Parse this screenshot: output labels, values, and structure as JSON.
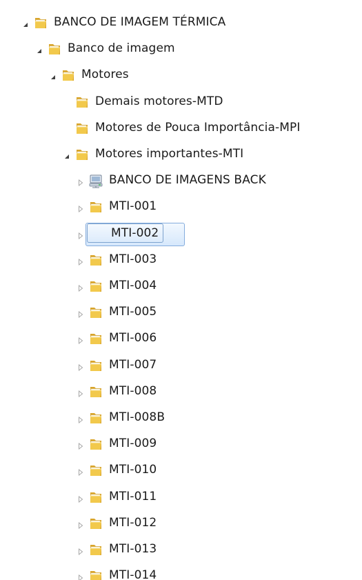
{
  "tree": {
    "selected_index": 6,
    "nodes": [
      {
        "label": "BANCO DE IMAGEM  TÉRMICA",
        "depth": 0,
        "expander": "expanded",
        "icon": "folder-icon"
      },
      {
        "label": "Banco de imagem",
        "depth": 1,
        "expander": "expanded",
        "icon": "folder-icon"
      },
      {
        "label": "Motores",
        "depth": 2,
        "expander": "expanded",
        "icon": "folder-icon"
      },
      {
        "label": "Demais motores-MTD",
        "depth": 3,
        "expander": "none",
        "icon": "folder-icon"
      },
      {
        "label": "Motores  de Pouca Importância-MPI",
        "depth": 3,
        "expander": "none",
        "icon": "folder-icon"
      },
      {
        "label": "Motores importantes-MTI",
        "depth": 3,
        "expander": "expanded",
        "icon": "folder-icon"
      },
      {
        "label": "BANCO DE IMAGENS BACK",
        "depth": 4,
        "expander": "collapsed",
        "icon": "network-drive-icon"
      },
      {
        "label": "MTI-001",
        "depth": 4,
        "expander": "collapsed",
        "icon": "folder-icon"
      },
      {
        "label": "MTI-002",
        "depth": 4,
        "expander": "collapsed",
        "icon": "folder-icon",
        "selected": true
      },
      {
        "label": "MTI-003",
        "depth": 4,
        "expander": "collapsed",
        "icon": "folder-icon"
      },
      {
        "label": "MTI-004",
        "depth": 4,
        "expander": "collapsed",
        "icon": "folder-icon"
      },
      {
        "label": "MTI-005",
        "depth": 4,
        "expander": "collapsed",
        "icon": "folder-icon"
      },
      {
        "label": "MTI-006",
        "depth": 4,
        "expander": "collapsed",
        "icon": "folder-icon"
      },
      {
        "label": "MTI-007",
        "depth": 4,
        "expander": "collapsed",
        "icon": "folder-icon"
      },
      {
        "label": "MTI-008",
        "depth": 4,
        "expander": "collapsed",
        "icon": "folder-icon"
      },
      {
        "label": "MTI-008B",
        "depth": 4,
        "expander": "collapsed",
        "icon": "folder-icon"
      },
      {
        "label": "MTI-009",
        "depth": 4,
        "expander": "collapsed",
        "icon": "folder-icon"
      },
      {
        "label": "MTI-010",
        "depth": 4,
        "expander": "collapsed",
        "icon": "folder-icon"
      },
      {
        "label": "MTI-011",
        "depth": 4,
        "expander": "collapsed",
        "icon": "folder-icon"
      },
      {
        "label": "MTI-012",
        "depth": 4,
        "expander": "collapsed",
        "icon": "folder-icon"
      },
      {
        "label": "MTI-013",
        "depth": 4,
        "expander": "collapsed",
        "icon": "folder-icon"
      },
      {
        "label": "MTI-014",
        "depth": 4,
        "expander": "collapsed",
        "icon": "folder-icon"
      }
    ]
  },
  "colors": {
    "folder_front": "#f2c94c",
    "folder_back": "#d9a52b",
    "folder_paper": "#ffffff",
    "selection_border": "#84acdd",
    "expander_collapsed": "#a6a6a6",
    "expander_expanded": "#404040"
  }
}
